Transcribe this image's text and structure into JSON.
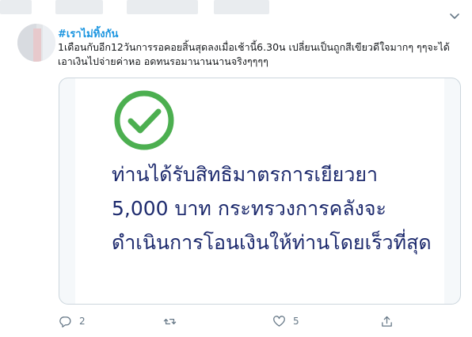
{
  "tweet": {
    "hashtag": "#เราไม่ทิ้งกัน",
    "text": "1เดือนกับอีก12วันการรอคอยสิ้นสุดลงเมื่อเช้านี้6.30น เปลี่ยนเป็นถูกสีเขียวดีใจมากๆ ๆๆจะได้เอาเงินไปจ่ายค่าหอ อดทนรอมานานนานจริงๆๆๆๆ"
  },
  "card": {
    "icon": "green-check-circle-icon",
    "message": "ท่านได้รับสิทธิมาตรการเยียวยา 5,000 บาท กระทรวงการคลังจะดำเนินการโอนเงินให้ท่านโดยเร็วที่สุด"
  },
  "actions": {
    "reply_count": "2",
    "like_count": "5"
  },
  "colors": {
    "hashtag": "#1b95e0",
    "check_green": "#4caf50",
    "message_navy": "#1e2b6e",
    "icon_gray": "#657786"
  }
}
